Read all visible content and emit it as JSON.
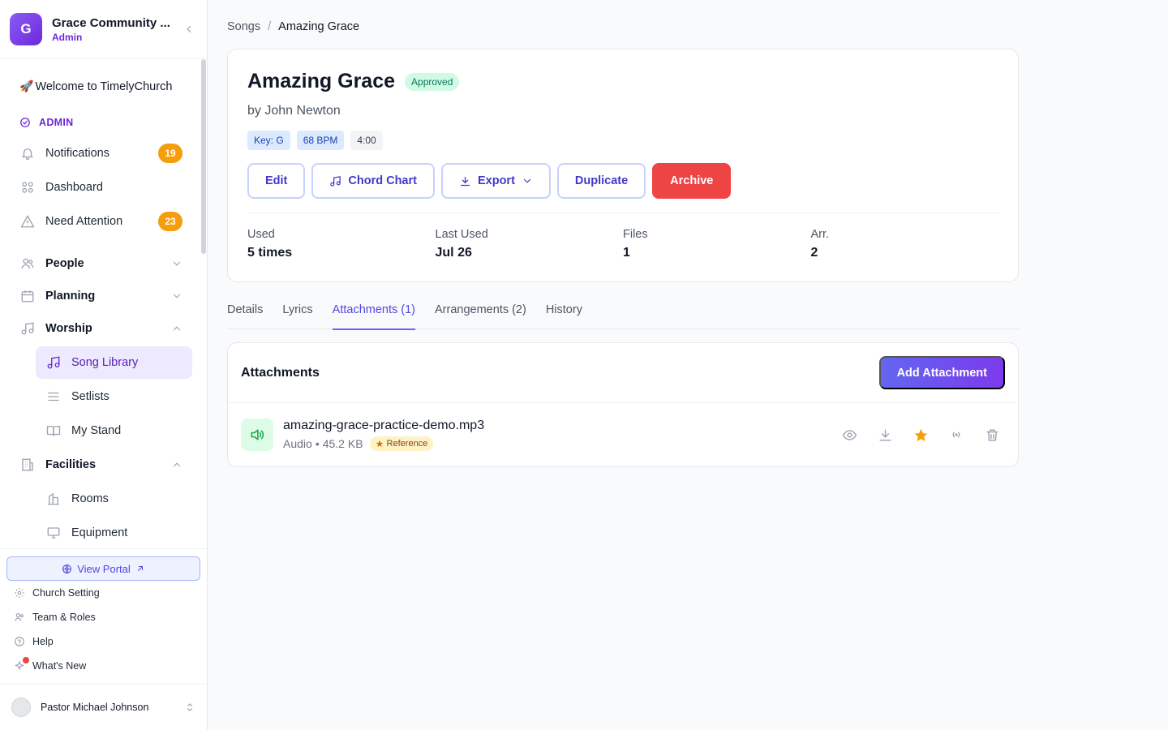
{
  "org": {
    "initial": "G",
    "name": "Grace Community ...",
    "role": "Admin"
  },
  "nav": {
    "welcome": "Welcome to TimelyChurch",
    "section": "ADMIN",
    "notifications": {
      "label": "Notifications",
      "count": "19"
    },
    "dashboard": "Dashboard",
    "need_attention": {
      "label": "Need Attention",
      "count": "23"
    },
    "people": "People",
    "planning": "Planning",
    "worship": "Worship",
    "song_library": "Song Library",
    "setlists": "Setlists",
    "my_stand": "My Stand",
    "facilities": "Facilities",
    "rooms": "Rooms",
    "equipment": "Equipment"
  },
  "bottom": {
    "view_portal": "View Portal",
    "church_setting": "Church Setting",
    "team_roles": "Team & Roles",
    "help": "Help",
    "whats_new": "What's New",
    "user_name": "Pastor Michael Johnson"
  },
  "breadcrumb": {
    "parent": "Songs",
    "separator": "/",
    "current": "Amazing Grace"
  },
  "song": {
    "title": "Amazing Grace",
    "status": "Approved",
    "author": "by John Newton",
    "key": "Key: G",
    "bpm": "68 BPM",
    "duration": "4:00"
  },
  "actions": {
    "edit": "Edit",
    "chord_chart": "Chord Chart",
    "export": "Export",
    "duplicate": "Duplicate",
    "archive": "Archive"
  },
  "stats": [
    {
      "label": "Used",
      "value": "5 times"
    },
    {
      "label": "Last Used",
      "value": "Jul 26"
    },
    {
      "label": "Files",
      "value": "1"
    },
    {
      "label": "Arr.",
      "value": "2"
    }
  ],
  "tabs": [
    "Details",
    "Lyrics",
    "Attachments (1)",
    "Arrangements (2)",
    "History"
  ],
  "attachments": {
    "title": "Attachments",
    "add_label": "Add Attachment",
    "file": {
      "name": "amazing-grace-practice-demo.mp3",
      "type": "Audio",
      "bullet": "•",
      "size": "45.2 KB",
      "badge": "Reference"
    }
  },
  "colors": {
    "accent": "#6366f1",
    "danger": "#ef4444",
    "badge": "#f59e0b",
    "success": "#047857"
  }
}
